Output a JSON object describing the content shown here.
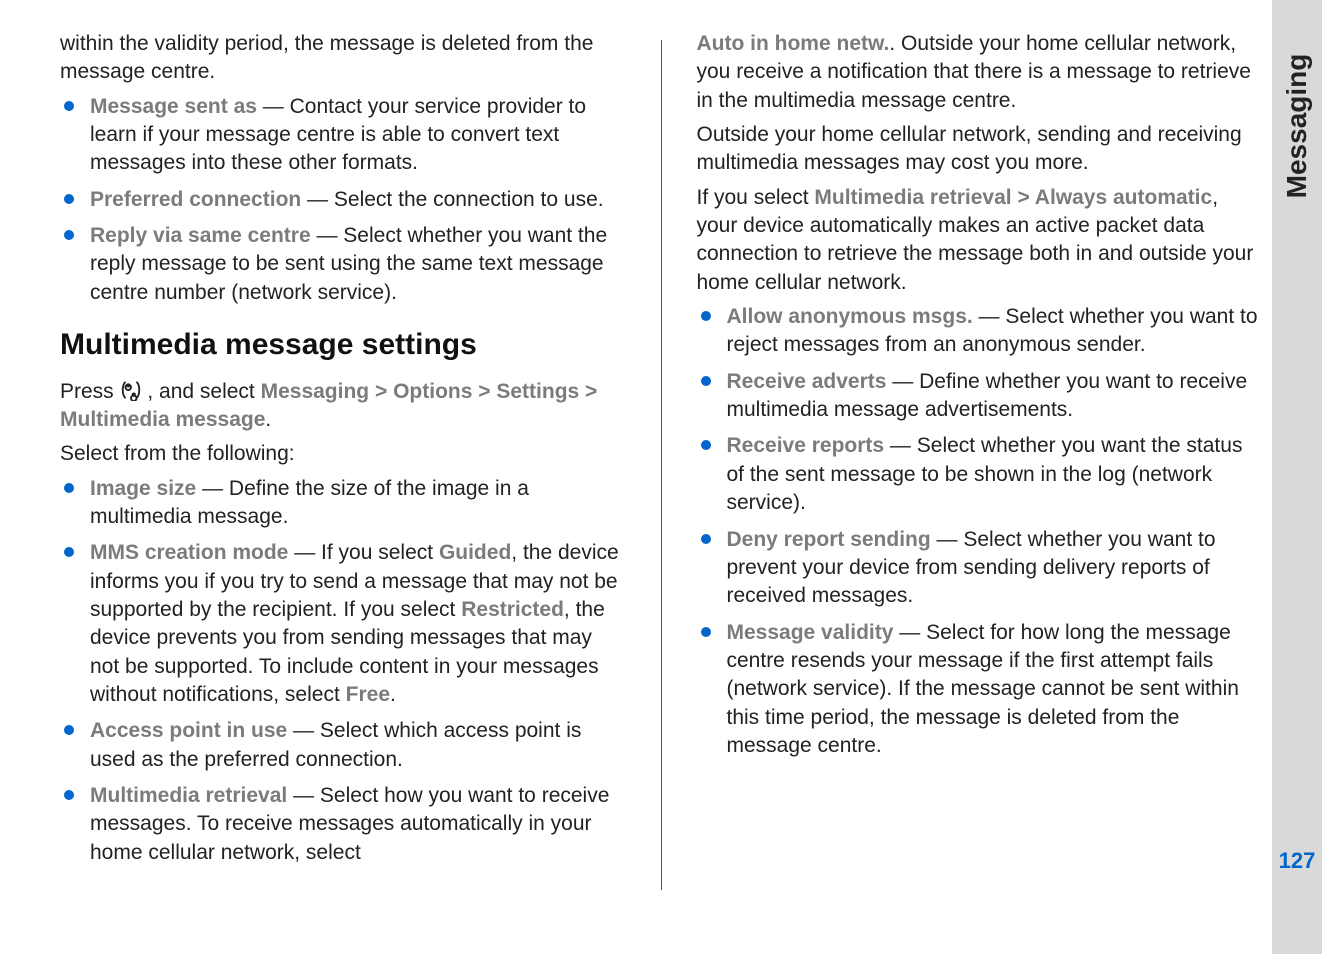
{
  "tab": {
    "section": "Messaging",
    "page": "127"
  },
  "left": {
    "intro_cont": "within the validity period, the message is deleted from the message centre.",
    "items_top": [
      {
        "label": "Message sent as",
        "text": " — Contact your service provider to learn if your message centre is able to convert text messages into these other formats."
      },
      {
        "label": "Preferred connection",
        "text": " — Select the connection to use."
      },
      {
        "label": "Reply via same centre",
        "text": " — Select whether you want the reply message to be sent using the same text message centre number (network service)."
      }
    ],
    "heading": "Multimedia message settings",
    "press": "Press ",
    "and_select": " , and select ",
    "path": {
      "a": "Messaging",
      "b": "Options",
      "c": "Settings",
      "d": "Multimedia message"
    },
    "period": ".",
    "select_from": "Select from the following:",
    "items_bottom": [
      {
        "label": "Image size",
        "text": " — Define the size of the image in a multimedia message."
      },
      {
        "label": "MMS creation mode",
        "pre": " — If you select ",
        "g1": "Guided",
        "mid1": ", the device informs you if you try to send a message that may not be supported by the recipient. If you select ",
        "g2": "Restricted",
        "mid2": ", the device prevents you from sending messages that may not be supported. To include content in your messages without notifications, select ",
        "g3": "Free",
        "end": "."
      },
      {
        "label": "Access point in use",
        "text": " — Select which access point is used as the preferred connection."
      },
      {
        "label": "Multimedia retrieval",
        "text": " — Select how you want to receive messages. To receive messages automatically in your home cellular network, select "
      }
    ]
  },
  "right": {
    "cont_label": "Auto in home netw.",
    "cont_text": ". Outside your home cellular network, you receive a notification that there is a message to retrieve in the multimedia message centre.",
    "p1": "Outside your home cellular network, sending and receiving multimedia messages may cost you more.",
    "p2_a": "If you select ",
    "p2_l1": "Multimedia retrieval",
    "p2_gt": " > ",
    "p2_l2": "Always automatic",
    "p2_b": ", your device automatically makes an active packet data connection to retrieve the message both in and outside your home cellular network.",
    "items": [
      {
        "label": "Allow anonymous msgs.",
        "text": " — Select whether you want to reject messages from an anonymous sender."
      },
      {
        "label": "Receive adverts",
        "text": " — Define whether you want to receive multimedia message advertisements."
      },
      {
        "label": "Receive reports",
        "text": " — Select whether you want the status of the sent message to be shown in the log (network service)."
      },
      {
        "label": "Deny report sending",
        "text": " — Select whether you want to prevent your device from sending delivery reports of received messages."
      },
      {
        "label": "Message validity",
        "text": " — Select for how long the message centre resends your message if the first attempt fails (network service). If the message cannot be sent within this time period, the message is deleted from the message centre."
      }
    ]
  }
}
